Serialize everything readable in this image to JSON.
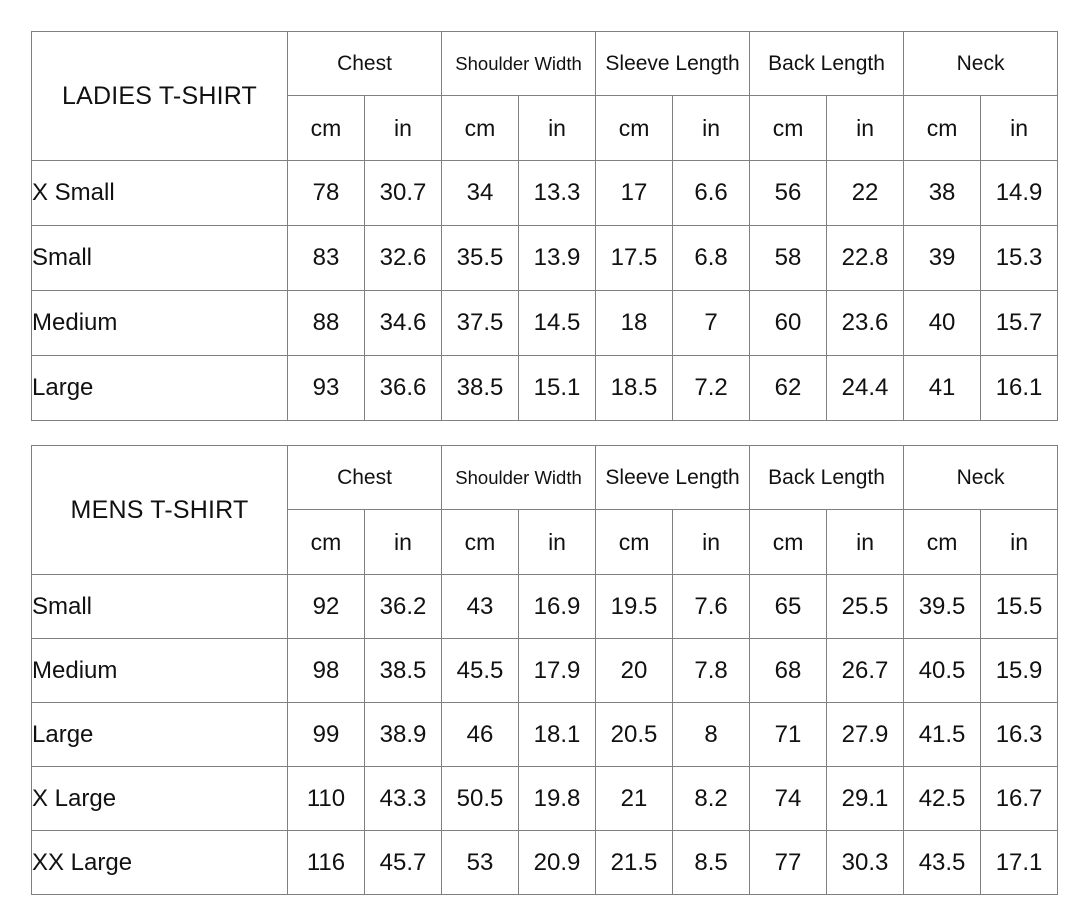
{
  "tables": [
    {
      "id": "ladies-t-shirt",
      "title": "LADIES T-SHIRT",
      "measurements": [
        "Chest",
        "Shoulder Width",
        "Sleeve Length",
        "Back Length",
        "Neck"
      ],
      "units": [
        "cm",
        "in"
      ],
      "unit_row": [
        "cm",
        "in",
        "cm",
        "in",
        "cm",
        "in",
        "cm",
        "in",
        "cm",
        "in"
      ],
      "rows": [
        {
          "size": "X Small",
          "values": [
            "78",
            "30.7",
            "34",
            "13.3",
            "17",
            "6.6",
            "56",
            "22",
            "38",
            "14.9"
          ]
        },
        {
          "size": "Small",
          "values": [
            "83",
            "32.6",
            "35.5",
            "13.9",
            "17.5",
            "6.8",
            "58",
            "22.8",
            "39",
            "15.3"
          ]
        },
        {
          "size": "Medium",
          "values": [
            "88",
            "34.6",
            "37.5",
            "14.5",
            "18",
            "7",
            "60",
            "23.6",
            "40",
            "15.7"
          ]
        },
        {
          "size": "Large",
          "values": [
            "93",
            "36.6",
            "38.5",
            "15.1",
            "18.5",
            "7.2",
            "62",
            "24.4",
            "41",
            "16.1"
          ]
        }
      ]
    },
    {
      "id": "mens-t-shirt",
      "title": "MENS T-SHIRT",
      "measurements": [
        "Chest",
        "Shoulder Width",
        "Sleeve Length",
        "Back Length",
        "Neck"
      ],
      "units": [
        "cm",
        "in"
      ],
      "unit_row": [
        "cm",
        "in",
        "cm",
        "in",
        "cm",
        "in",
        "cm",
        "in",
        "cm",
        "in"
      ],
      "rows": [
        {
          "size": "Small",
          "values": [
            "92",
            "36.2",
            "43",
            "16.9",
            "19.5",
            "7.6",
            "65",
            "25.5",
            "39.5",
            "15.5"
          ]
        },
        {
          "size": "Medium",
          "values": [
            "98",
            "38.5",
            "45.5",
            "17.9",
            "20",
            "7.8",
            "68",
            "26.7",
            "40.5",
            "15.9"
          ]
        },
        {
          "size": "Large",
          "values": [
            "99",
            "38.9",
            "46",
            "18.1",
            "20.5",
            "8",
            "71",
            "27.9",
            "41.5",
            "16.3"
          ]
        },
        {
          "size": "X Large",
          "values": [
            "110",
            "43.3",
            "50.5",
            "19.8",
            "21",
            "8.2",
            "74",
            "29.1",
            "42.5",
            "16.7"
          ]
        },
        {
          "size": "XX Large",
          "values": [
            "116",
            "45.7",
            "53",
            "20.9",
            "21.5",
            "8.5",
            "77",
            "30.3",
            "43.5",
            "17.1"
          ]
        }
      ]
    }
  ],
  "colors": {
    "border": "#808080",
    "text": "#111111",
    "background": "#ffffff"
  }
}
